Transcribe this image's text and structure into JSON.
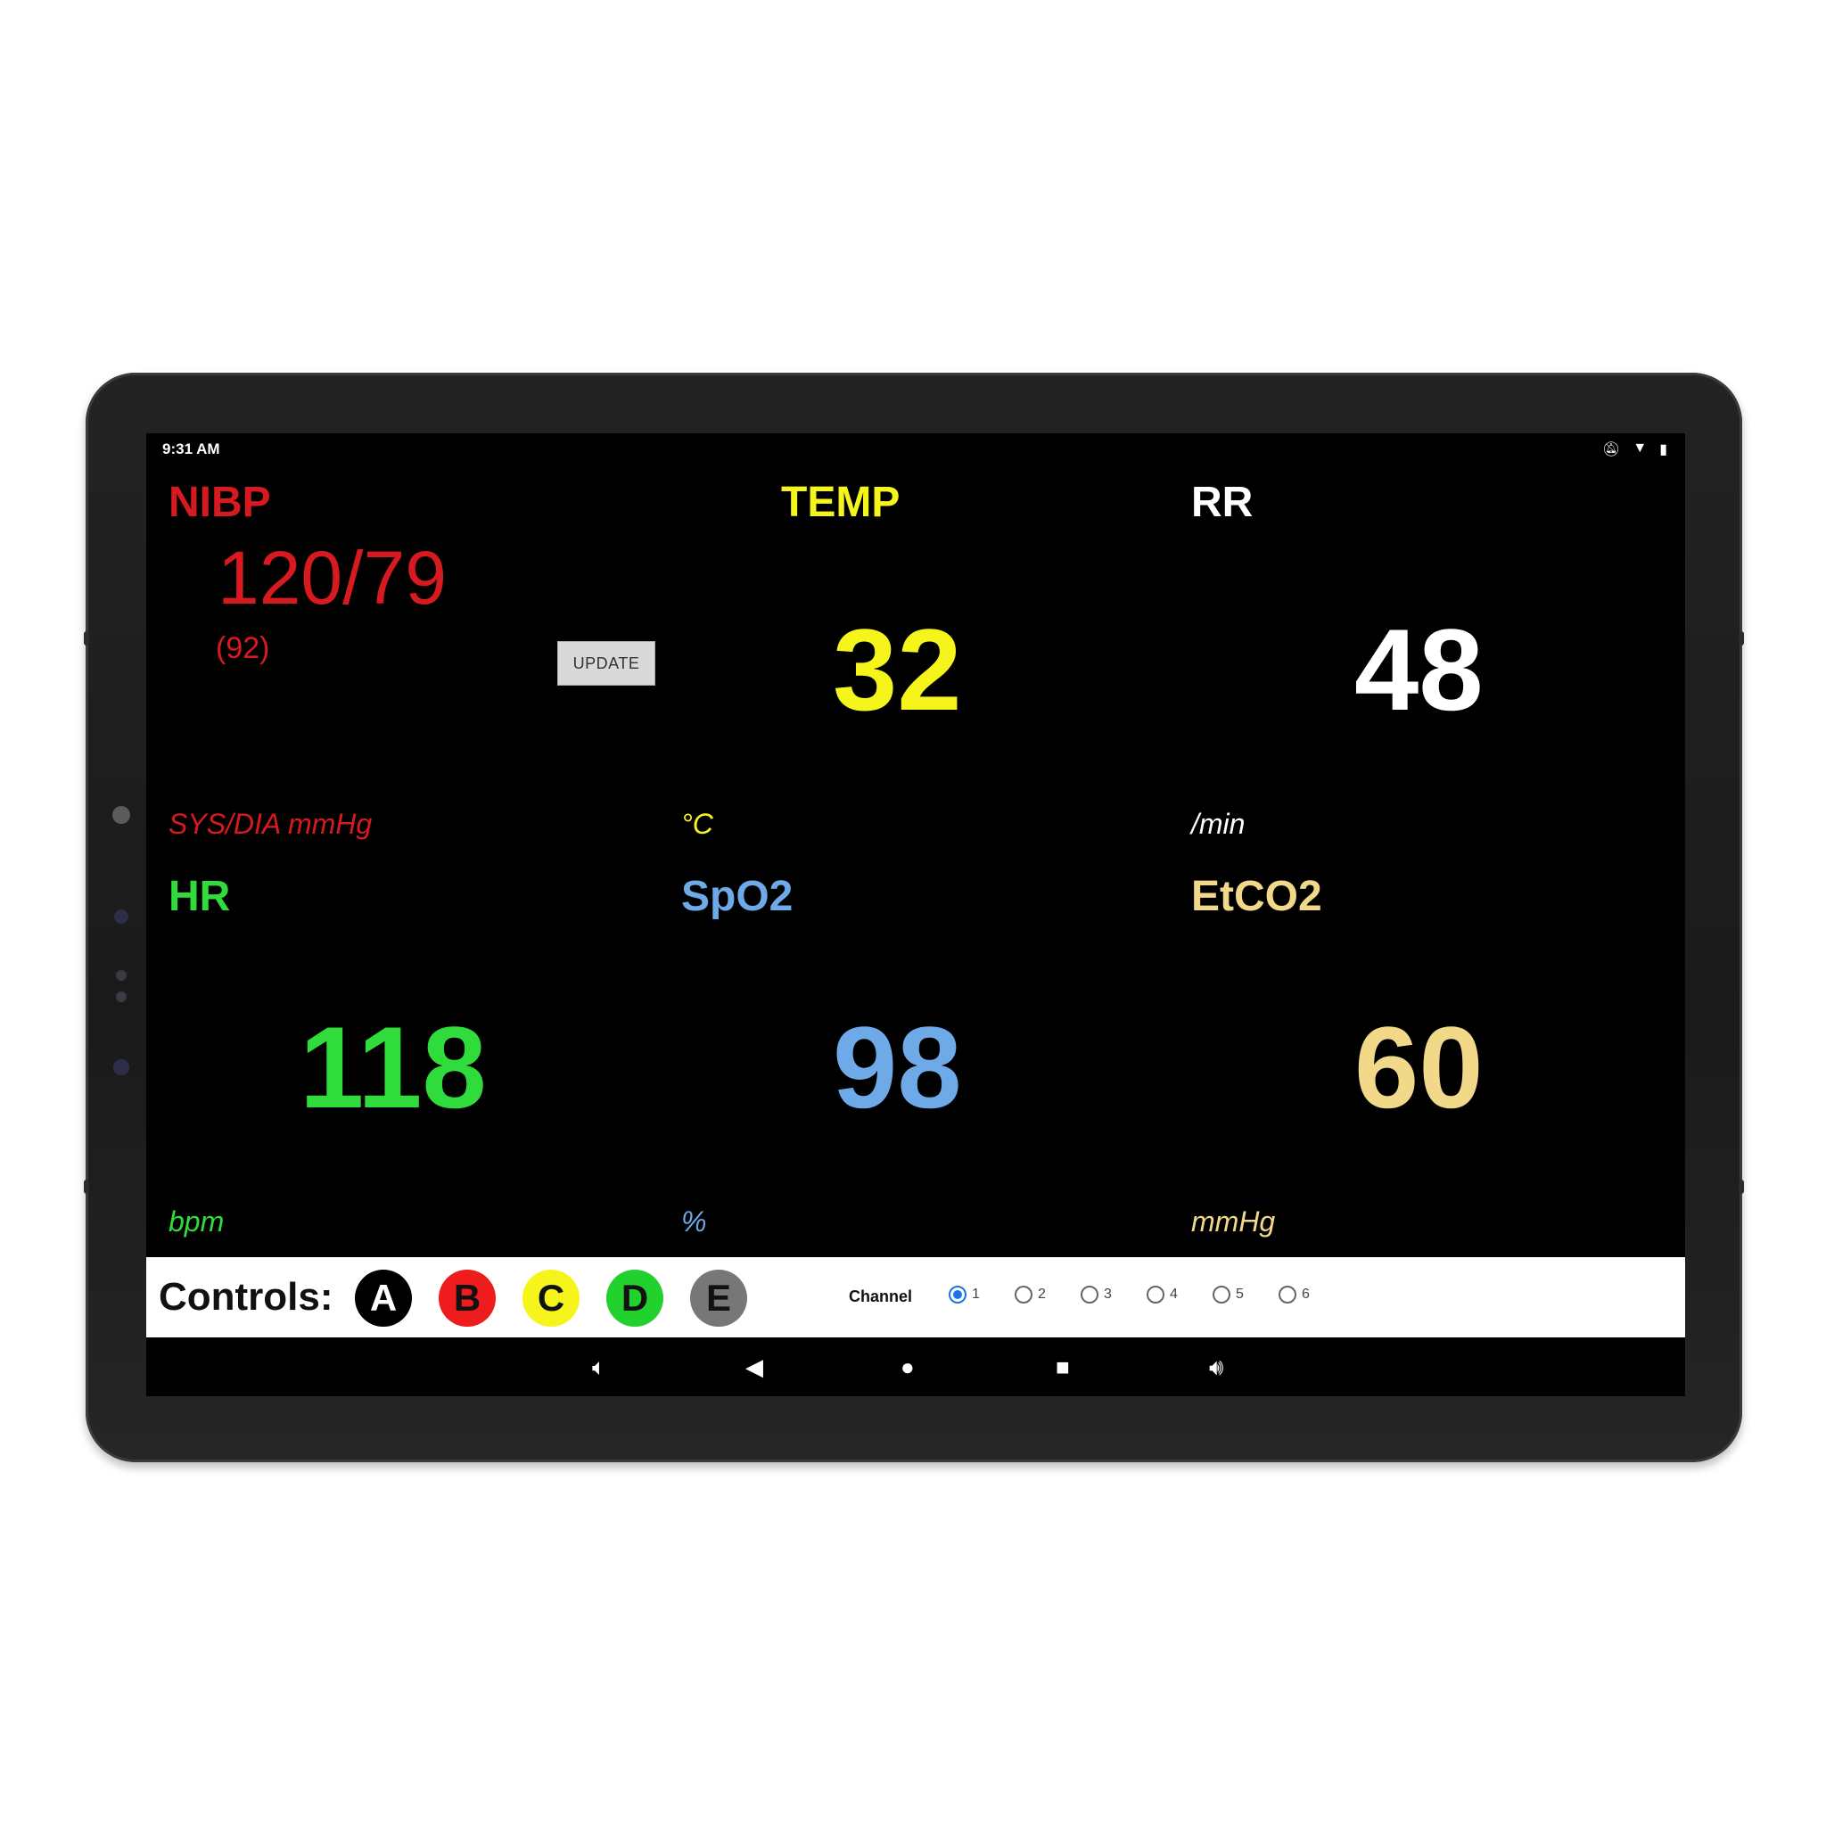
{
  "status": {
    "time": "9:31 AM",
    "icons": [
      "mute-icon",
      "wifi-icon",
      "battery-icon"
    ]
  },
  "vitals": {
    "nibp": {
      "title": "NIBP",
      "value": "120/79",
      "mean": "(92)",
      "unit": "SYS/DIA mmHg",
      "color": "#d71920"
    },
    "temp": {
      "title": "TEMP",
      "value": "32",
      "unit": "°C",
      "color": "#f5f51b"
    },
    "rr": {
      "title": "RR",
      "value": "48",
      "unit": "/min",
      "color": "#ffffff"
    },
    "hr": {
      "title": "HR",
      "value": "118",
      "unit": "bpm",
      "color": "#2fdc3c"
    },
    "spo2": {
      "title": "SpO2",
      "value": "98",
      "unit": "%",
      "color": "#6ea9e8"
    },
    "etco2": {
      "title": "EtCO2",
      "value": "60",
      "unit": "mmHg",
      "color": "#f2d98a"
    }
  },
  "update_label": "UPDATE",
  "controls": {
    "label": "Controls:",
    "buttons": [
      {
        "label": "A",
        "color": "#000000"
      },
      {
        "label": "B",
        "color": "#ee1c1c"
      },
      {
        "label": "C",
        "color": "#f5f51b"
      },
      {
        "label": "D",
        "color": "#22d02e"
      },
      {
        "label": "E",
        "color": "#777777"
      }
    ],
    "channel_label": "Channel",
    "channels": [
      "1",
      "2",
      "3",
      "4",
      "5",
      "6"
    ],
    "selected_channel": "1"
  },
  "nav": [
    "volume-down-icon",
    "back-icon",
    "home-icon",
    "recents-icon",
    "volume-up-icon"
  ]
}
